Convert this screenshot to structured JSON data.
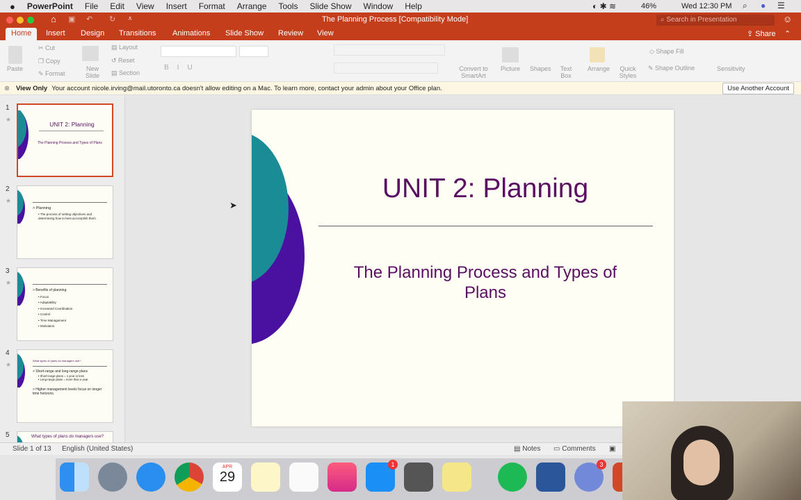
{
  "menubar": {
    "app": "PowerPoint",
    "items": [
      "File",
      "Edit",
      "View",
      "Insert",
      "Format",
      "Arrange",
      "Tools",
      "Slide Show",
      "Window",
      "Help"
    ],
    "battery": "46%",
    "clock": "Wed 12:30 PM"
  },
  "window": {
    "title": "The Planning Process [Compatibility Mode]",
    "search_placeholder": "Search in Presentation",
    "share": "Share"
  },
  "tabs": [
    "Home",
    "Insert",
    "Design",
    "Transitions",
    "Animations",
    "Slide Show",
    "Review",
    "View"
  ],
  "ribbon": {
    "paste": "Paste",
    "cut": "Cut",
    "copy": "Copy",
    "format": "Format",
    "new_slide": "New Slide",
    "layout": "Layout",
    "reset": "Reset",
    "section": "Section",
    "convert": "Convert to SmartArt",
    "picture": "Picture",
    "shapes": "Shapes",
    "text_box": "Text Box",
    "arrange": "Arrange",
    "quick_styles": "Quick Styles",
    "shape_fill": "Shape Fill",
    "shape_outline": "Shape Outline",
    "sensitivity": "Sensitivity"
  },
  "infobar": {
    "label": "View Only",
    "message": "Your account nicole.irving@mail.utoronto.ca doesn't allow editing on a Mac. To learn more, contact your admin about your Office plan.",
    "button": "Use Another Account"
  },
  "thumbs": [
    {
      "num": "1",
      "title": "UNIT 2: Planning",
      "sub": "The Planning Process and Types of Plans"
    },
    {
      "num": "2",
      "head": "> Planning",
      "lines": [
        "• The process of setting objectives and determining how to best accomplish them"
      ]
    },
    {
      "num": "3",
      "head": "> Benefits of planning:",
      "lines": [
        "• Focus",
        "• Adaptability",
        "• Increased Coordination",
        "• Control",
        "• Time Management",
        "• Motivation"
      ]
    },
    {
      "num": "4",
      "top": "What types of plans do managers use?",
      "head": "> Short-range and long-range plans",
      "lines": [
        "• Short-range plans = 1 year or less",
        "• Long-range plans = more than a year"
      ],
      "head2": "> Higher management levels focus on longer time horizons."
    },
    {
      "num": "5",
      "top": "What types of plans do managers use?"
    }
  ],
  "slide": {
    "title": "UNIT 2: Planning",
    "subtitle": "The Planning Process and Types of Plans"
  },
  "status": {
    "slide": "Slide 1 of 13",
    "language": "English (United States)",
    "notes": "Notes",
    "comments": "Comments"
  },
  "dock": {
    "calendar_month": "APR",
    "calendar_day": "29",
    "app_store_badge": "1",
    "discord_badge": "3"
  },
  "colors": {
    "accent": "#c43e1c",
    "slide_text": "#5a0f62",
    "teal": "#1a8c96",
    "purple": "#4a10a0"
  }
}
